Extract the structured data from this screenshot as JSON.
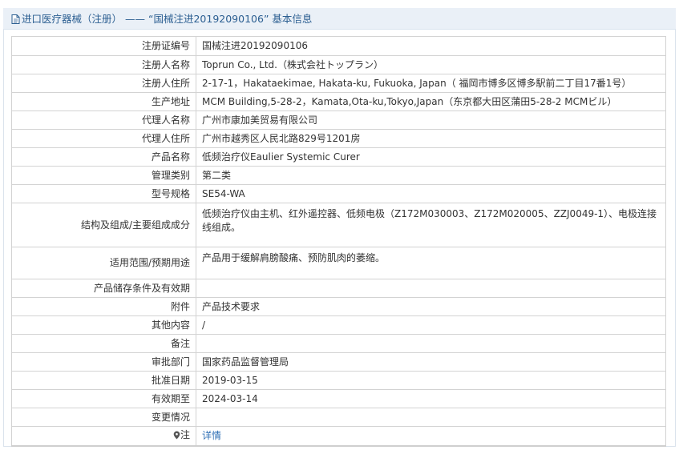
{
  "header": {
    "crumb_category": "进口医疗器械（注册）",
    "crumb_separator": "——",
    "crumb_record": "“国械注进20192090106”",
    "crumb_suffix": "基本信息"
  },
  "rows": [
    {
      "label": "注册证编号",
      "value": "国械注进20192090106"
    },
    {
      "label": "注册人名称",
      "value": "Toprun Co., Ltd.（株式会社トップラン）"
    },
    {
      "label": "注册人住所",
      "value": "2-17-1，Hakataekimae, Hakata-ku, Fukuoka, Japan（ 福岡市博多区博多駅前二丁目17番1号）"
    },
    {
      "label": "生产地址",
      "value": "MCM Building,5-28-2，Kamata,Ota-ku,Tokyo,Japan（东京都大田区蒲田5-28-2 MCMビル）"
    },
    {
      "label": "代理人名称",
      "value": "广州市康加美贸易有限公司"
    },
    {
      "label": "代理人住所",
      "value": "广州市越秀区人民北路829号1201房"
    },
    {
      "label": "产品名称",
      "value": "低频治疗仪Eaulier Systemic Curer"
    },
    {
      "label": "管理类别",
      "value": "第二类"
    },
    {
      "label": "型号规格",
      "value": "SE54-WA"
    },
    {
      "label": "结构及组成/主要组成成分",
      "value": "低频治疗仪由主机、红外遥控器、低频电极（Z172M030003、Z172M020005、ZZJ0049-1）、电极连接线组成。"
    },
    {
      "label": "适用范围/预期用途",
      "value": "产品用于缓解肩膀酸痛、预防肌肉的萎缩。"
    },
    {
      "label": "产品储存条件及有效期",
      "value": ""
    },
    {
      "label": "附件",
      "value": "产品技术要求"
    },
    {
      "label": "其他内容",
      "value": "/"
    },
    {
      "label": "备注",
      "value": ""
    },
    {
      "label": "审批部门",
      "value": "国家药品监督管理局"
    },
    {
      "label": "批准日期",
      "value": "2019-03-15"
    },
    {
      "label": "有效期至",
      "value": "2024-03-14"
    },
    {
      "label": "变更情况",
      "value": ""
    }
  ],
  "note_row": {
    "label": "注",
    "link_text": "详情",
    "icon": "map-pin-icon"
  },
  "icons": {
    "header": "document-icon"
  },
  "colors": {
    "header_bg": "#eaf0f7",
    "header_text": "#2b5e91",
    "link": "#2f6fb5",
    "border": "#d3d3d3"
  }
}
